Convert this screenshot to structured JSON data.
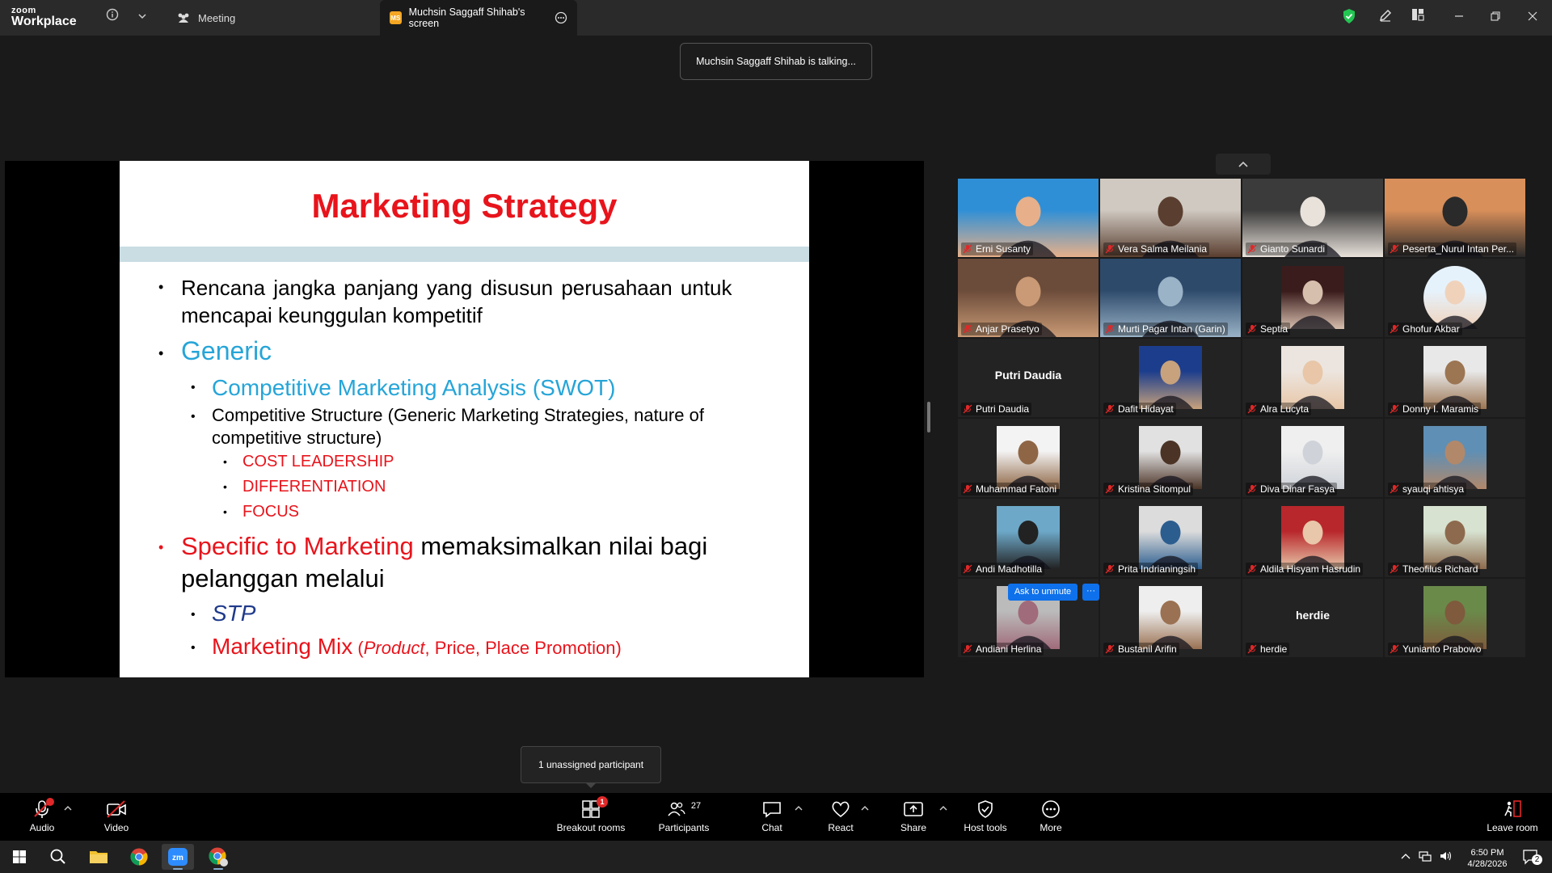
{
  "app": {
    "logo_small": "zoom",
    "logo_big": "Workplace"
  },
  "tabs": [
    {
      "label": "Meeting"
    },
    {
      "badge": "MS",
      "label": "Muchsin Saggaff Shihab's screen"
    }
  ],
  "talking_indicator": "Muchsin Saggaff Shihab is talking...",
  "slide": {
    "title": "Marketing Strategy",
    "line1": "Rencana jangka panjang yang disusun perusahaan untuk",
    "line1b": "mencapai keunggulan kompetitif",
    "generic": "Generic",
    "competitive_analysis": "Competitive Marketing Analysis (SWOT)",
    "competitive_structure_1": "Competitive Structure (Generic Marketing Strategies, nature of",
    "competitive_structure_2": "competitive structure)",
    "cost_leadership": "COST LEADERSHIP",
    "differentiation": "DIFFERENTIATION",
    "focus": "FOCUS",
    "specific_red": "Specific to Marketing",
    "specific_black": " memaksimalkan nilai bagi",
    "specific_2": "pelanggan melalui",
    "stp": "STP",
    "mix_red": "Marketing Mix",
    "mix_open": " (",
    "mix_product": "Product",
    "mix_rest": ", Price, Place Promotion)"
  },
  "participants_gallery": [
    {
      "name": "Erni Susanty",
      "type": "video"
    },
    {
      "name": "Vera Salma Meilania",
      "type": "video"
    },
    {
      "name": "Gianto Sunardi",
      "type": "video"
    },
    {
      "name": "Peserta_Nurul Intan Per...",
      "type": "video"
    },
    {
      "name": "Anjar Prasetyo",
      "type": "video"
    },
    {
      "name": "Murti Pagar Intan (Garin)",
      "type": "video"
    },
    {
      "name": "Septia",
      "type": "photo"
    },
    {
      "name": "Ghofur Akbar",
      "type": "photo"
    },
    {
      "name": "Putri Daudia",
      "type": "nameonly",
      "display": "Putri Daudia"
    },
    {
      "name": "Dafit Hidayat",
      "type": "photo"
    },
    {
      "name": "Alra Lucyta",
      "type": "photo"
    },
    {
      "name": "Donny I. Maramis",
      "type": "photo"
    },
    {
      "name": "Muhammad Fatoni",
      "type": "photo"
    },
    {
      "name": "Kristina Sitompul",
      "type": "photo"
    },
    {
      "name": "Diva Dinar Fasya",
      "type": "photo"
    },
    {
      "name": "syauqi ahtisya",
      "type": "photo"
    },
    {
      "name": "Andi Madhotilla",
      "type": "photo"
    },
    {
      "name": "Prita Indrianingsih",
      "type": "photo"
    },
    {
      "name": "Aldila Hisyam Hasrudin",
      "type": "photo"
    },
    {
      "name": "Theofilus Richard",
      "type": "photo"
    },
    {
      "name": "Andiani Herlina",
      "type": "photo"
    },
    {
      "name": "Bustanil Arifin",
      "type": "photo"
    },
    {
      "name": "herdie",
      "type": "nameonly",
      "display": "herdie"
    },
    {
      "name": "Yunianto Prabowo",
      "type": "photo"
    }
  ],
  "ask_to_unmute": "Ask to unmute",
  "ask_more": "···",
  "unassigned_tooltip": "1 unassigned participant",
  "controls": {
    "audio": "Audio",
    "video": "Video",
    "breakout": "Breakout rooms",
    "breakout_badge": "1",
    "participants": "Participants",
    "participants_count": "27",
    "chat": "Chat",
    "react": "React",
    "share": "Share",
    "host_tools": "Host tools",
    "more": "More",
    "leave": "Leave room"
  },
  "taskbar": {
    "time": "6:50 PM",
    "date": "4/28/2026",
    "notifications": "2"
  },
  "colors": {
    "accent_blue": "#0e71eb",
    "slide_red": "#e8141c",
    "slide_blue": "#26a5d8",
    "shield_green": "#23c552",
    "mute_red": "#e02828"
  }
}
